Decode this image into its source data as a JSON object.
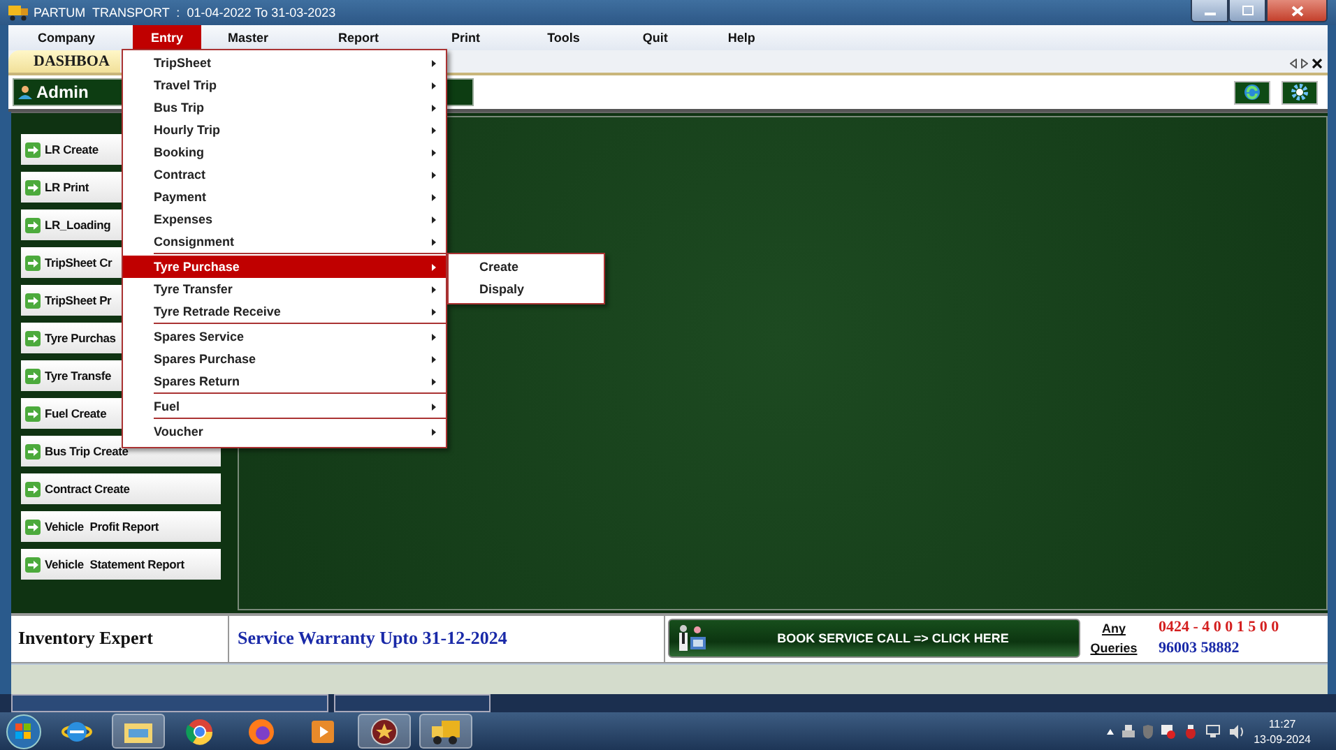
{
  "window": {
    "title": "PARTUM  TRANSPORT  :  01-04-2022 To 31-03-2023"
  },
  "menu_bar": [
    {
      "label": "Company",
      "selected": false
    },
    {
      "label": "Entry",
      "selected": true
    },
    {
      "label": "Master",
      "selected": false
    },
    {
      "label": "Report",
      "selected": false
    },
    {
      "label": "Print",
      "selected": false
    },
    {
      "label": "Tools",
      "selected": false
    },
    {
      "label": "Quit",
      "selected": false
    },
    {
      "label": "Help",
      "selected": false
    }
  ],
  "entry_menu": {
    "items": [
      {
        "label": "TripSheet",
        "selected": false,
        "separator_after": false
      },
      {
        "label": "Travel Trip",
        "selected": false,
        "separator_after": false
      },
      {
        "label": "Bus Trip",
        "selected": false,
        "separator_after": false
      },
      {
        "label": "Hourly Trip",
        "selected": false,
        "separator_after": false
      },
      {
        "label": "Booking",
        "selected": false,
        "separator_after": false
      },
      {
        "label": "Contract",
        "selected": false,
        "separator_after": false
      },
      {
        "label": "Payment",
        "selected": false,
        "separator_after": false
      },
      {
        "label": "Expenses",
        "selected": false,
        "separator_after": false
      },
      {
        "label": "Consignment",
        "selected": false,
        "separator_after": true
      },
      {
        "label": "Tyre Purchase",
        "selected": true,
        "separator_after": false
      },
      {
        "label": "Tyre Transfer",
        "selected": false,
        "separator_after": false
      },
      {
        "label": "Tyre Retrade Receive",
        "selected": false,
        "separator_after": true
      },
      {
        "label": "Spares Service",
        "selected": false,
        "separator_after": false
      },
      {
        "label": "Spares Purchase",
        "selected": false,
        "separator_after": false
      },
      {
        "label": "Spares Return",
        "selected": false,
        "separator_after": true
      },
      {
        "label": "Fuel",
        "selected": false,
        "separator_after": true
      },
      {
        "label": "Voucher",
        "selected": false,
        "separator_after": false
      }
    ],
    "submenu": {
      "items": [
        {
          "label": "Create"
        },
        {
          "label": "Dispaly"
        }
      ]
    }
  },
  "tab": {
    "label": "DASHBOA"
  },
  "header": {
    "user": "Admin"
  },
  "quick_buttons": [
    "LR Create",
    "LR Print",
    "LR_Loading",
    "TripSheet Cr",
    "TripSheet Pr",
    "Tyre Purchas",
    "Tyre Transfe",
    "Fuel Create",
    "Bus Trip Create",
    "Contract Create",
    "Vehicle  Profit Report",
    "Vehicle  Statement Report"
  ],
  "footer": {
    "product": "Inventory Expert",
    "warranty": "Service Warranty Upto 31-12-2024",
    "service_button": "BOOK SERVICE CALL => CLICK HERE",
    "queries_label": "Any Queries",
    "phones": [
      {
        "number": "0424 - 4 0 0 1 5 0 0",
        "color": "#d42020"
      },
      {
        "number": "96003 58882",
        "color": "#1a2aa8"
      }
    ]
  },
  "taskbar": {
    "time": "11:27",
    "date": "13-09-2024"
  }
}
